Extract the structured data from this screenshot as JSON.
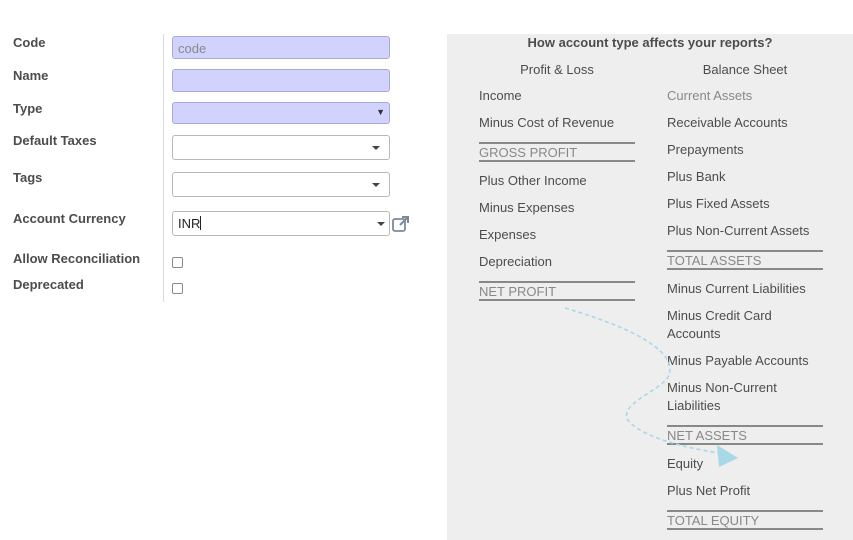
{
  "form": {
    "labels": {
      "code": "Code",
      "name": "Name",
      "type": "Type",
      "default_taxes": "Default Taxes",
      "tags": "Tags",
      "account_currency": "Account Currency",
      "allow_reconciliation": "Allow Reconciliation",
      "deprecated": "Deprecated"
    },
    "code": {
      "value": "",
      "placeholder": "code"
    },
    "name": {
      "value": ""
    },
    "type": {
      "value": ""
    },
    "default_taxes": {
      "value": ""
    },
    "tags": {
      "value": ""
    },
    "account_currency": {
      "value": "INR"
    },
    "allow_reconciliation": {
      "checked": false
    },
    "deprecated": {
      "checked": false
    },
    "external_link_icon": "external-link-icon"
  },
  "help_panel": {
    "title": "How account type affects your reports?",
    "profit_loss": {
      "heading": "Profit & Loss",
      "items": [
        "Income",
        "Minus Cost of Revenue"
      ],
      "gross_profit": "GROSS PROFIT",
      "items2": [
        "Plus Other Income",
        "Minus Expenses",
        "Expenses",
        "Depreciation"
      ],
      "net_profit": "NET PROFIT"
    },
    "balance_sheet": {
      "heading": "Balance Sheet",
      "current_assets": "Current Assets",
      "items": [
        "Receivable Accounts",
        "Prepayments",
        "Plus Bank",
        "Plus Fixed Assets",
        "Plus Non-Current Assets"
      ],
      "total_assets": "TOTAL ASSETS",
      "items2": [
        "Minus Current Liabilities",
        "Minus Credit Card Accounts",
        "Minus Payable Accounts",
        "Minus Non-Current Liabilities"
      ],
      "net_assets": "NET ASSETS",
      "items3": [
        "Equity",
        "Plus Net Profit"
      ],
      "total_equity": "TOTAL EQUITY"
    },
    "arrow_color": "#a8d8e8"
  }
}
